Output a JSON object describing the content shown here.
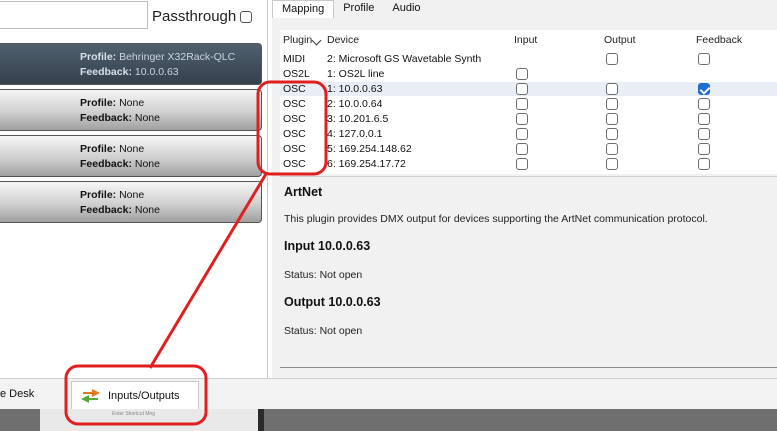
{
  "left": {
    "passthrough_label": "Passthrough",
    "universes": [
      {
        "profile_label": "Profile:",
        "profile": "Behringer X32Rack-QLC",
        "feedback_label": "Feedback:",
        "feedback": "10.0.0.63"
      },
      {
        "profile_label": "Profile:",
        "profile": "None",
        "feedback_label": "Feedback:",
        "feedback": "None"
      },
      {
        "profile_label": "Profile:",
        "profile": "None",
        "feedback_label": "Feedback:",
        "feedback": "None"
      },
      {
        "profile_label": "Profile:",
        "profile": "None",
        "feedback_label": "Feedback:",
        "feedback": "None"
      }
    ]
  },
  "tabs": [
    "Mapping",
    "Profile",
    "Audio"
  ],
  "table": {
    "headers": {
      "plugin": "Plugin",
      "device": "Device",
      "input": "Input",
      "output": "Output",
      "feedback": "Feedback"
    },
    "rows": [
      {
        "plugin": "MIDI",
        "device": "2: Microsoft GS Wavetable Synth",
        "input": null,
        "output": false,
        "feedback": false
      },
      {
        "plugin": "OS2L",
        "device": "1: OS2L line",
        "input": false,
        "output": null,
        "feedback": null
      },
      {
        "plugin": "OSC",
        "device": "1: 10.0.0.63",
        "input": false,
        "output": false,
        "feedback": true
      },
      {
        "plugin": "OSC",
        "device": "2: 10.0.0.64",
        "input": false,
        "output": false,
        "feedback": false
      },
      {
        "plugin": "OSC",
        "device": "3: 10.201.6.5",
        "input": false,
        "output": false,
        "feedback": false
      },
      {
        "plugin": "OSC",
        "device": "4: 127.0.0.1",
        "input": false,
        "output": false,
        "feedback": false
      },
      {
        "plugin": "OSC",
        "device": "5: 169.254.148.62",
        "input": false,
        "output": false,
        "feedback": false
      },
      {
        "plugin": "OSC",
        "device": "6: 169.254.17.72",
        "input": false,
        "output": false,
        "feedback": false
      }
    ]
  },
  "info": {
    "title": "ArtNet",
    "description": "This plugin provides DMX output for devices supporting the ArtNet communication protocol.",
    "input_heading": "Input 10.0.0.63",
    "input_status": "Status: Not open",
    "output_heading": "Output 10.0.0.63",
    "output_status": "Status: Not open"
  },
  "bottom": {
    "desk_tab": "e Desk",
    "io_tab": "Inputs/Outputs",
    "faint_text": "Enter Shortcut Mng"
  },
  "colors": {
    "annotation": "#e02020",
    "checkbox_checked": "#1f6fd1",
    "selected_universe": "#3d4a57"
  }
}
